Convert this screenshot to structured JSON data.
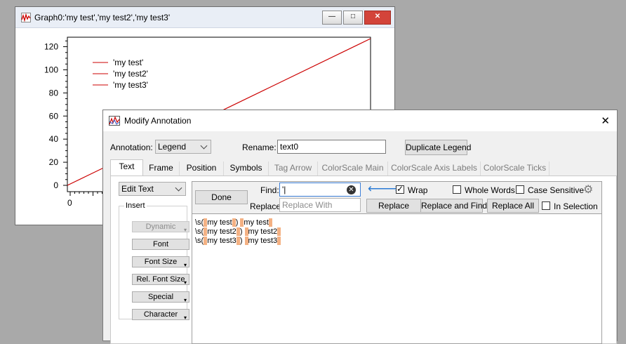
{
  "graph": {
    "title": "Graph0:'my test','my test2','my test3'",
    "legend": [
      "'my test'",
      "'my test2'",
      "'my test3'"
    ],
    "y_ticks": [
      "120",
      "100",
      "80",
      "60",
      "40",
      "20",
      "0"
    ],
    "x_ticks": [
      "0"
    ],
    "line_color": "#cc0000"
  },
  "chart_data": {
    "type": "line",
    "series": [
      {
        "name": "'my test'",
        "x": [
          0,
          127
        ],
        "y": [
          0,
          127
        ]
      },
      {
        "name": "'my test2'",
        "x": [
          0,
          127
        ],
        "y": [
          0,
          127
        ]
      },
      {
        "name": "'my test3'",
        "x": [
          0,
          127
        ],
        "y": [
          0,
          127
        ]
      }
    ],
    "ylim": [
      0,
      127
    ],
    "y_ticks": [
      0,
      20,
      40,
      60,
      80,
      100,
      120
    ],
    "legend_position": "top-left"
  },
  "dialog": {
    "title": "Modify Annotation",
    "annotation_label": "Annotation:",
    "annotation_value": "Legend",
    "rename_label": "Rename:",
    "rename_value": "text0",
    "duplicate_button": "Duplicate Legend",
    "tabs": [
      "Text",
      "Frame",
      "Position",
      "Symbols",
      "Tag Arrow",
      "ColorScale Main",
      "ColorScale Axis Labels",
      "ColorScale Ticks"
    ],
    "edit_mode": "Edit Text",
    "insert_label": "Insert",
    "insert_buttons": [
      "Dynamic",
      "Font",
      "Font Size",
      "Rel. Font Size",
      "Special",
      "Character"
    ],
    "done_button": "Done",
    "find_label": "Find:",
    "find_value": "'|",
    "replace_label": "Replace:",
    "replace_placeholder": "Replace With",
    "wrap_label": "Wrap",
    "whole_words_label": "Whole Words",
    "case_sensitive_label": "Case Sensitive",
    "in_selection_label": "In Selection",
    "replace_button": "Replace",
    "replace_find_button": "Replace and Find",
    "replace_all_button": "Replace All",
    "text_lines": [
      {
        "pre": "\\s(",
        "mid": "my test",
        "post": ") ",
        "tail": "my test"
      },
      {
        "pre": "\\s(",
        "mid": "my test2",
        "post": ") ",
        "tail": "my test2"
      },
      {
        "pre": "\\s(",
        "mid": "my test3",
        "post": ") ",
        "tail": "my test3"
      }
    ]
  }
}
